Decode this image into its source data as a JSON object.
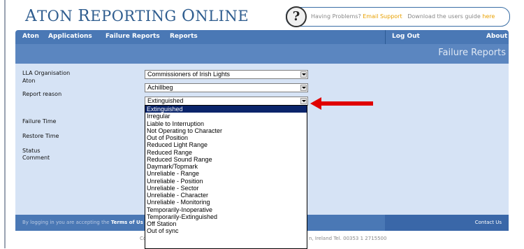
{
  "brand": {
    "first": "A",
    "rest": "TON ",
    "second": "R",
    "rest2": "EPORTING ",
    "third": "O",
    "rest3": "NLINE"
  },
  "help": {
    "question_glyph": "?",
    "text": "Having Problems?",
    "link1": "Email Support",
    "text2": "Download the users guide",
    "link2": "here"
  },
  "nav": {
    "items": [
      "Aton",
      "Applications",
      "Failure Reports",
      "Reports"
    ],
    "logout": "Log Out",
    "about": "About"
  },
  "banner": {
    "title": "Failure Reports"
  },
  "form": {
    "lla_label": "LLA Organisation",
    "lla_value": "Commissioners of Irish Lights",
    "aton_label": "Aton",
    "aton_value": "Achillbeg",
    "reason_label": "Report reason",
    "reason_value": "Extinguished",
    "failure_time_label": "Failure Time",
    "restore_time_label": "Restore Time",
    "status_label": "Status",
    "comment_label": "Comment"
  },
  "dropdown": {
    "options": [
      "Extinguished",
      "Irregular",
      "Liable to Interruption",
      "Not Operating to Character",
      "Out of Position",
      "Reduced Light Range",
      "Reduced Range",
      "Reduced Sound Range",
      "Daymark/Topmark",
      "Unreliable - Range",
      "Unreliable - Position",
      "Unreliable - Sector",
      "Unreliable - Character",
      "Unreliable - Monitoring",
      "Temporarily-Inoperative",
      "Temporarily-Extinguished",
      "Off Station",
      "Out of sync"
    ],
    "selected_index": 0
  },
  "footer": {
    "left_prefix": "By logging in you are accepting the",
    "terms_link": "Terms of Us",
    "contact": "Contact Us",
    "copyright_left": "Co",
    "copyright_right": "n, Ireland Tel. 00353 1 2715500"
  },
  "colors": {
    "nav": "#4a78b5",
    "banner": "#5b86c0",
    "content": "#d6e3f5",
    "selected_option": "#0a246a",
    "arrow": "#e00000",
    "link": "#e8a000"
  }
}
